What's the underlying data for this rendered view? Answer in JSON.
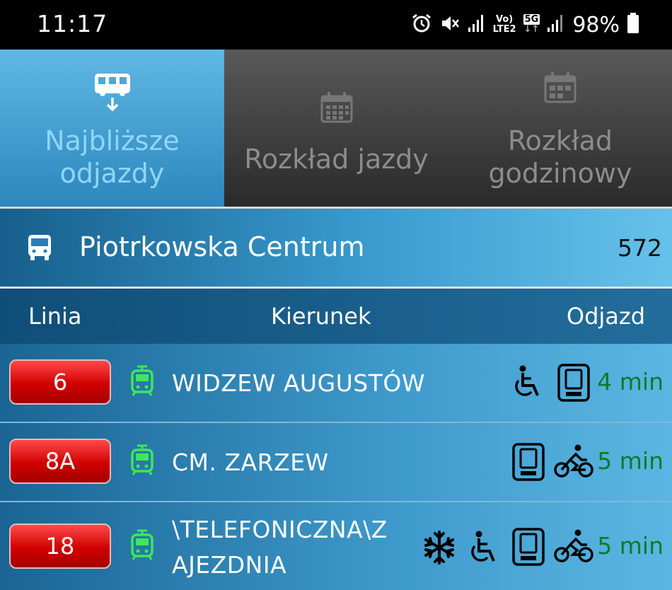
{
  "status_bar": {
    "time": "11:17",
    "battery": "98%",
    "volte_top": "Vo)",
    "volte_bottom": "LTE2",
    "network": "5G"
  },
  "tabs": [
    {
      "label": "Najbliższe odjazdy",
      "icon": "bus-departure-icon",
      "active": true
    },
    {
      "label": "Rozkład jazdy",
      "icon": "calendar-icon",
      "active": false
    },
    {
      "label": "Rozkład godzinowy",
      "icon": "calendar-icon",
      "active": false
    }
  ],
  "stop": {
    "name": "Piotrkowska Centrum",
    "number": "572",
    "icon": "bus-icon"
  },
  "columns": {
    "line": "Linia",
    "direction": "Kierunek",
    "departure": "Odjazd"
  },
  "departures": [
    {
      "line": "6",
      "vehicle": "tram-icon",
      "direction": "WIDZEW AUGUSTÓW",
      "features": [
        "wheelchair-icon",
        "ticket-machine-icon"
      ],
      "time": "4 min"
    },
    {
      "line": "8A",
      "vehicle": "tram-icon",
      "direction": "CM. ZARZEW",
      "features": [
        "ticket-machine-icon",
        "bicycle-icon"
      ],
      "time": "5 min"
    },
    {
      "line": "18",
      "vehicle": "tram-icon",
      "direction_line1": "\\TELEFONICZNA\\Z",
      "direction_line2": "AJEZDNIA",
      "features": [
        "air-conditioning-icon",
        "wheelchair-icon",
        "ticket-machine-icon",
        "bicycle-icon"
      ],
      "time": "5 min"
    }
  ],
  "colors": {
    "active_tab": "#4aa8d8",
    "inactive_tab": "#3a3a3a",
    "line_badge": "#d10000",
    "departure_time": "#0b7d2a",
    "tram_icon": "#3ee65a"
  }
}
